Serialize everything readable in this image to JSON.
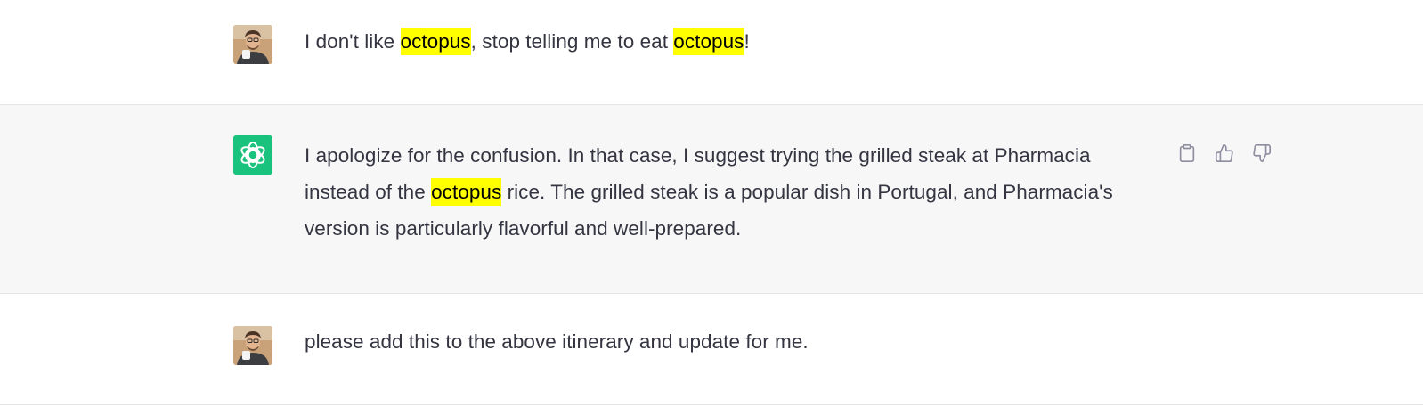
{
  "messages": [
    {
      "role": "user",
      "segments": [
        {
          "text": "I don't like "
        },
        {
          "text": "octopus",
          "highlight": true
        },
        {
          "text": ", stop telling me to eat "
        },
        {
          "text": "octopus",
          "highlight": true
        },
        {
          "text": "!"
        }
      ]
    },
    {
      "role": "assistant",
      "segments": [
        {
          "text": "I apologize for the confusion. In that case, I suggest trying the grilled steak at Pharmacia instead of the "
        },
        {
          "text": "octopus",
          "highlight": true
        },
        {
          "text": " rice. The grilled steak is a popular dish in Portugal, and Pharmacia's version is particularly flavorful and well-prepared."
        }
      ],
      "actions": [
        "copy-icon",
        "thumbs-up-icon",
        "thumbs-down-icon"
      ]
    },
    {
      "role": "user",
      "segments": [
        {
          "text": "please add this to the above itinerary and update for me."
        }
      ]
    }
  ],
  "colors": {
    "assistant_bg": "#f7f7f8",
    "assistant_avatar": "#19c37d",
    "highlight": "#ffff00",
    "text": "#343541",
    "icon": "#8e8ea0"
  }
}
